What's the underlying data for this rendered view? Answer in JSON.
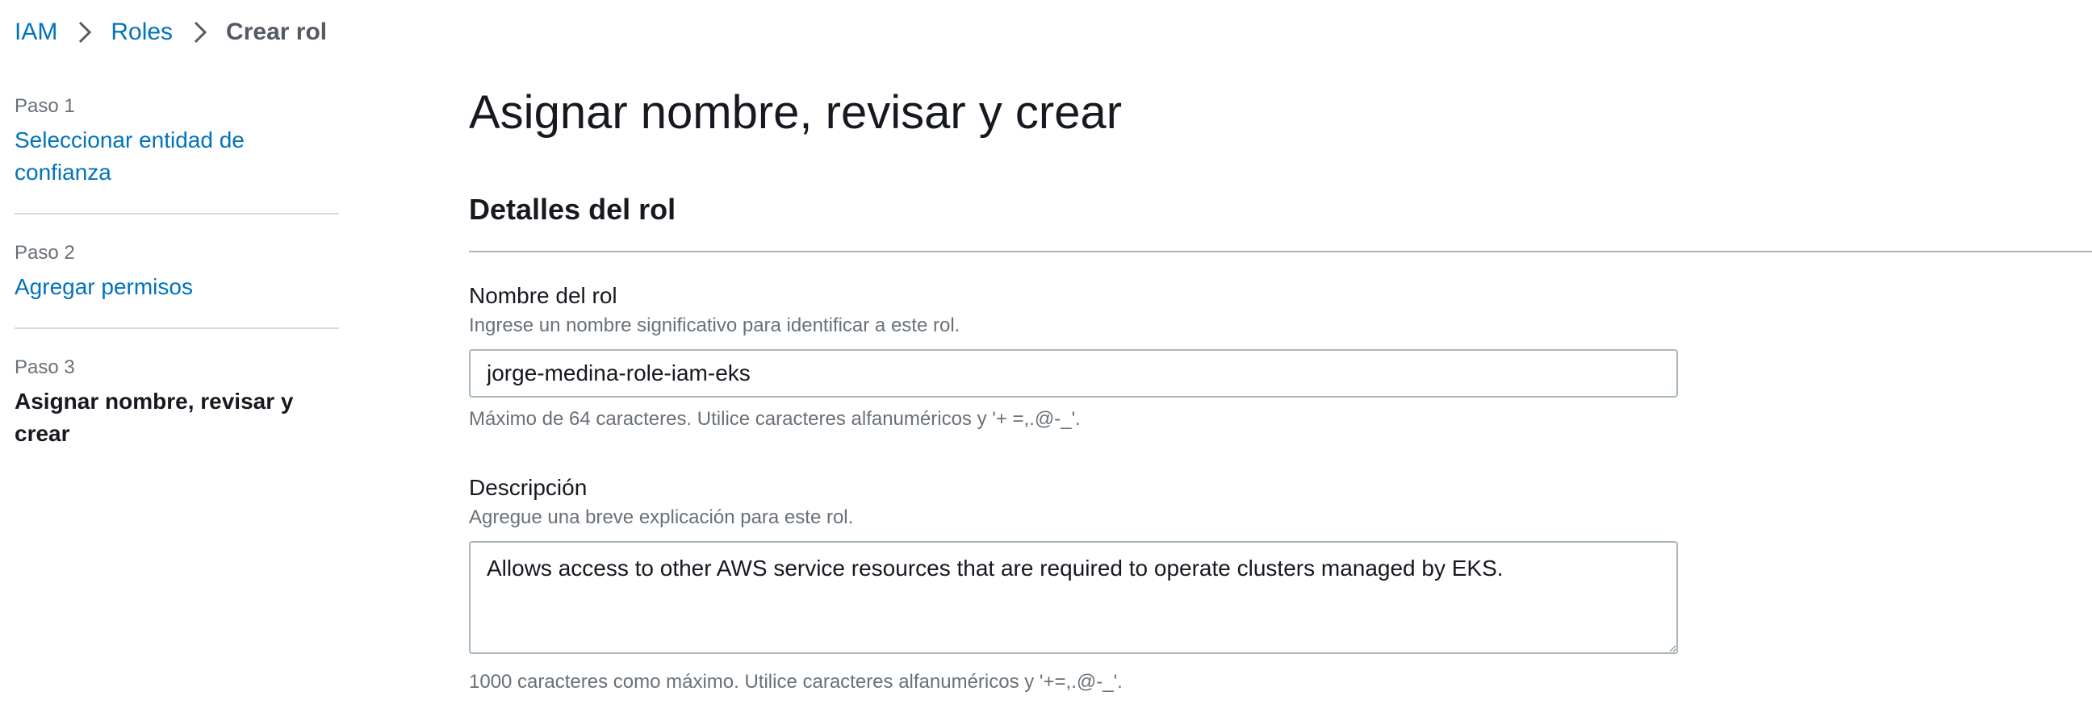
{
  "breadcrumb": {
    "items": [
      "IAM",
      "Roles"
    ],
    "current": "Crear rol"
  },
  "steps": [
    {
      "number": "Paso 1",
      "title": "Seleccionar entidad de confianza"
    },
    {
      "number": "Paso 2",
      "title": "Agregar permisos"
    },
    {
      "number": "Paso 3",
      "title": "Asignar nombre, revisar y crear"
    }
  ],
  "main": {
    "title": "Asignar nombre, revisar y crear",
    "section_title": "Detalles del rol",
    "role_name": {
      "label": "Nombre del rol",
      "description": "Ingrese un nombre significativo para identificar a este rol.",
      "value": "jorge-medina-role-iam-eks",
      "hint": "Máximo de 64 caracteres. Utilice caracteres alfanuméricos y '+ =,.@-_'."
    },
    "description": {
      "label": "Descripción",
      "description": "Agregue una breve explicación para este rol.",
      "value": "Allows access to other AWS service resources that are required to operate clusters managed by EKS.",
      "hint": "1000 caracteres como máximo. Utilice caracteres alfanuméricos y '+=,.@-_'."
    }
  },
  "colors": {
    "link": "#0073bb",
    "text": "#16191f",
    "muted": "#687078",
    "border": "#aab7b8"
  }
}
